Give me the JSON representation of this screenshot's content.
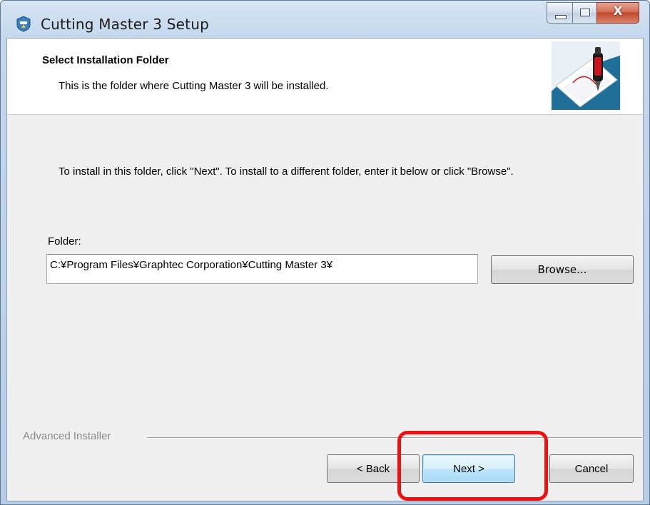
{
  "window": {
    "title": "Cutting Master 3 Setup",
    "icon": "setup-shield-icon",
    "controls": {
      "minimize": "minimize-icon",
      "maximize": "maximize-icon",
      "close_glyph": "X"
    }
  },
  "banner": {
    "title": "Select Installation Folder",
    "subtitle": "This is the folder where Cutting Master 3 will be installed.",
    "image": "cutter-blade-graphic"
  },
  "body": {
    "instruction": "To install in this folder, click \"Next\". To install to a different folder, enter it below or click \"Browse\".",
    "folder_label": "Folder:",
    "folder_value": "C:¥Program Files¥Graphtec Corporation¥Cutting Master 3¥",
    "browse_label": "Browse..."
  },
  "footer": {
    "brand": "Advanced Installer",
    "back_label": "< Back",
    "next_label": "Next >",
    "cancel_label": "Cancel"
  },
  "colors": {
    "highlight": "#ee1111",
    "next_border": "#3c7fb1",
    "window_frame": "#c3d6ec"
  }
}
